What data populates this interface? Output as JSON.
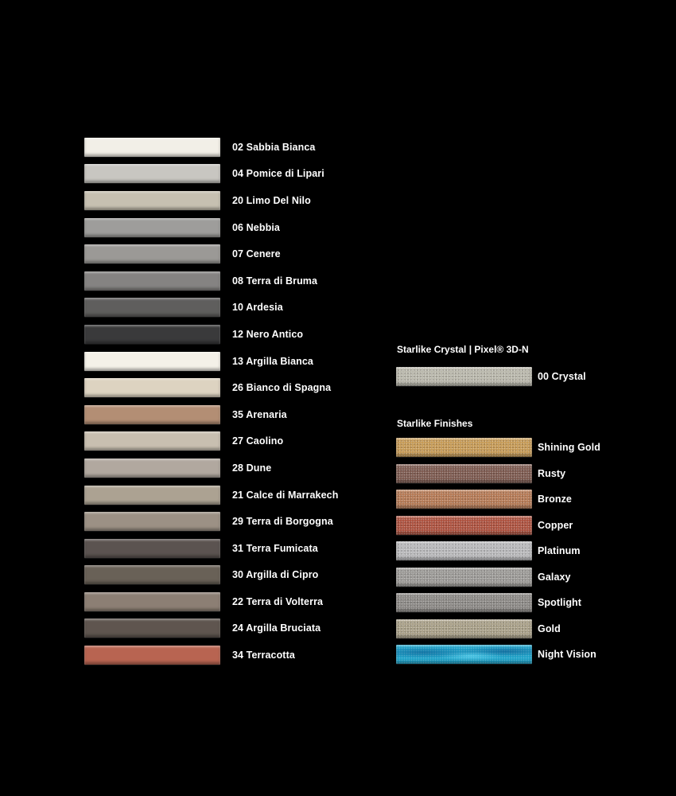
{
  "classic_colors": [
    {
      "label": "02 Sabbia Bianca",
      "color": "#f2efe7"
    },
    {
      "label": "04 Pomice di Lipari",
      "color": "#c8c6c1"
    },
    {
      "label": "20 Limo Del Nilo",
      "color": "#c6c0b1"
    },
    {
      "label": "06 Nebbia",
      "color": "#9e9d9b"
    },
    {
      "label": "07 Cenere",
      "color": "#9b9996"
    },
    {
      "label": "08 Terra di Bruma",
      "color": "#858382"
    },
    {
      "label": "10 Ardesia",
      "color": "#5f5e5d"
    },
    {
      "label": "12 Nero Antico",
      "color": "#3a3a3b"
    },
    {
      "label": "13 Argilla Bianca",
      "color": "#f4f1e8"
    },
    {
      "label": "26 Bianco di Spagna",
      "color": "#ddd3c1"
    },
    {
      "label": "35 Arenaria",
      "color": "#b38e74"
    },
    {
      "label": "27 Caolino",
      "color": "#c8bfb0"
    },
    {
      "label": "28 Dune",
      "color": "#b1a89f"
    },
    {
      "label": "21 Calce di Marrakech",
      "color": "#aca292"
    },
    {
      "label": "29 Terra di Borgogna",
      "color": "#9c9185"
    },
    {
      "label": "31 Terra Fumicata",
      "color": "#5b5350"
    },
    {
      "label": "30 Argilla di Cipro",
      "color": "#696157"
    },
    {
      "label": "22 Terra di Volterra",
      "color": "#8c7f74"
    },
    {
      "label": "24 Argilla Bruciata",
      "color": "#5f554f"
    },
    {
      "label": "34 Terracotta",
      "color": "#b86451"
    }
  ],
  "crystal_section": {
    "title": "Starlike Crystal | Pixel® 3D-N",
    "items": [
      {
        "label": "00 Crystal",
        "color": "#b9b7ab",
        "texture": "sparkle"
      }
    ]
  },
  "finishes_section": {
    "title": "Starlike Finishes",
    "items": [
      {
        "label": "Shining Gold",
        "color": "#c69a56",
        "texture": "sparkle"
      },
      {
        "label": "Rusty",
        "color": "#7d5a50",
        "texture": "sparkle"
      },
      {
        "label": "Bronze",
        "color": "#b57a55",
        "texture": "sparkle"
      },
      {
        "label": "Copper",
        "color": "#ad523f",
        "texture": "sparkle"
      },
      {
        "label": "Platinum",
        "color": "#b9b9bb",
        "texture": "sparkle"
      },
      {
        "label": "Galaxy",
        "color": "#9c9a97",
        "texture": "sparkle"
      },
      {
        "label": "Spotlight",
        "color": "#8c8986",
        "texture": "sparkle"
      },
      {
        "label": "Gold",
        "color": "#a9a088",
        "texture": "sparkle"
      },
      {
        "label": "Night Vision",
        "color": "#1fa2c8",
        "texture": "marble"
      }
    ]
  }
}
